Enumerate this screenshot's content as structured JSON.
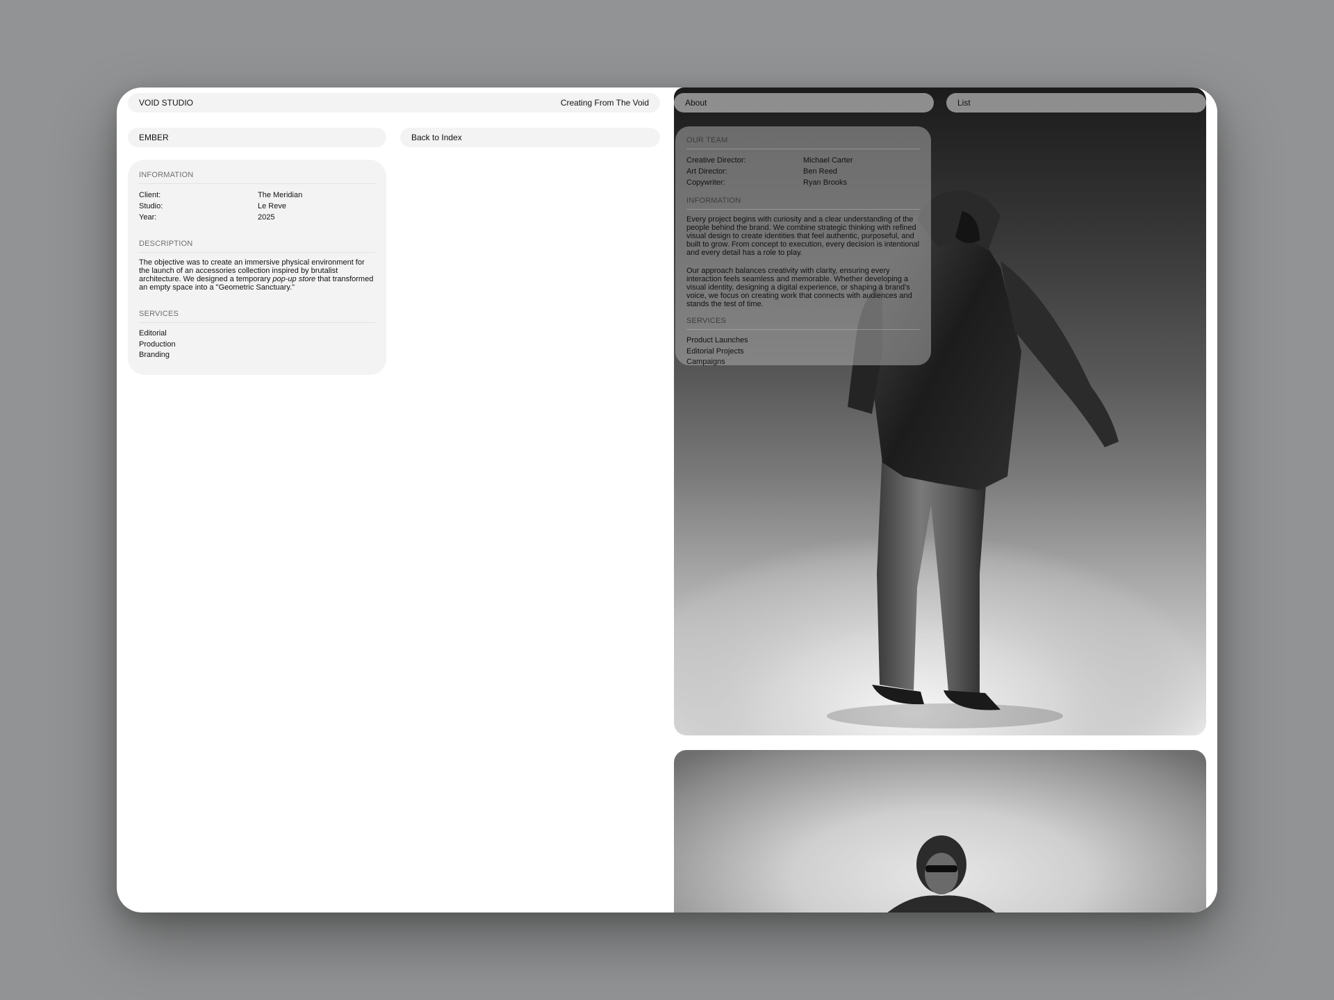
{
  "header": {
    "brand": "VOID STUDIO",
    "tagline": "Creating From The Void"
  },
  "project_bar": {
    "project_name": "EMBER",
    "back_label": "Back to Index"
  },
  "project_card": {
    "information_title": "INFORMATION",
    "info": [
      {
        "label": "Client:",
        "value": "The Meridian"
      },
      {
        "label": "Studio:",
        "value": "Le Reve"
      },
      {
        "label": "Year:",
        "value": "2025"
      }
    ],
    "description_title": "DESCRIPTION",
    "description_before": "The objective was to create an immersive physical environment for the launch of an accessories collection inspired by brutalist architecture. We designed a temporary ",
    "description_italic": "pop-up store",
    "description_after": " that transformed an empty space into a \"Geometric Sanctuary.\"",
    "services_title": "SERVICES",
    "services": [
      "Editorial",
      "Production",
      "Branding"
    ]
  },
  "nav": {
    "about_label": "About",
    "list_label": "List"
  },
  "about_overlay": {
    "team_title": "OUR TEAM",
    "team": [
      {
        "role": "Creative Director:",
        "name": "Michael Carter"
      },
      {
        "role": "Art Director:",
        "name": "Ben Reed"
      },
      {
        "role": "Copywriter:",
        "name": "Ryan Brooks"
      }
    ],
    "information_title": "INFORMATION",
    "paragraph_1": "Every project begins with curiosity and a clear understanding of the people behind the brand. We combine strategic thinking with refined visual design to create identities that feel authentic, purposeful, and built to grow. From concept to execution, every decision is intentional and every detail has a role to play.",
    "paragraph_2": "Our approach balances creativity with clarity, ensuring every interaction feels seamless and memorable. Whether developing a visual identity, designing a digital experience, or shaping a brand's voice, we focus on creating work that connects with audiences and stands the test of time.",
    "services_title": "SERVICES",
    "services": [
      "Product Launches",
      "Editorial Projects",
      "Campaigns"
    ]
  }
}
